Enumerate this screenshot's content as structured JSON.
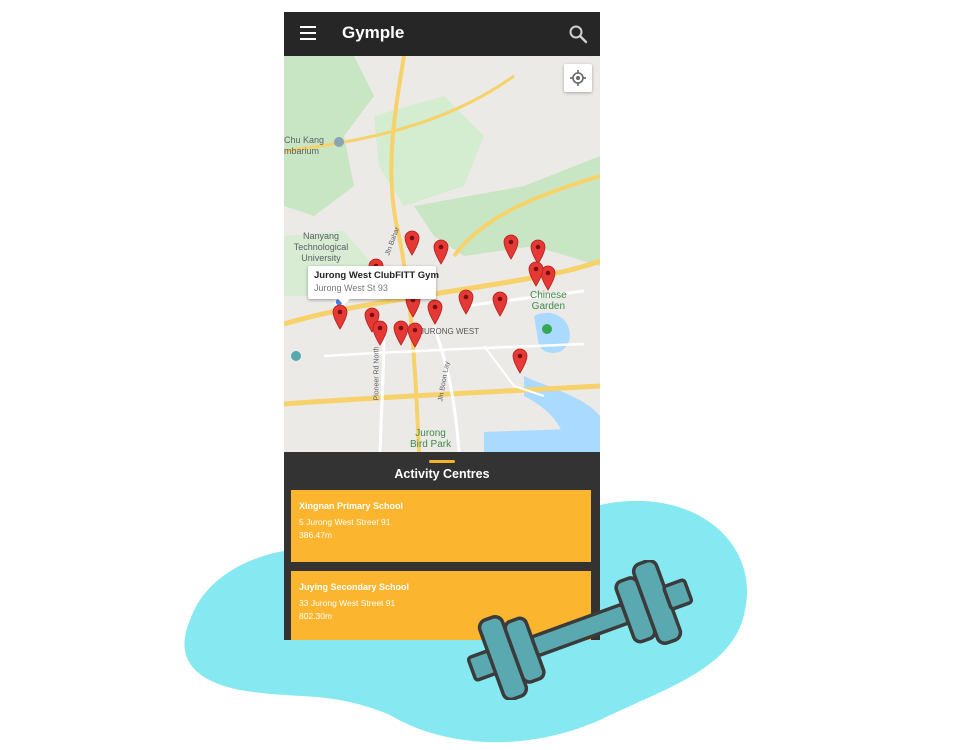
{
  "app": {
    "title": "Gymple"
  },
  "icons": {
    "menu": "hamburger-menu-icon",
    "search": "search-icon",
    "locate": "my-location-icon",
    "pin": "map-pin-icon"
  },
  "colors": {
    "accent": "#fbb52e",
    "appbar": "#262626",
    "sheet": "#333333",
    "pin": "#e53935",
    "blob": "#86e9f2",
    "dumbbell": "#5aa9b1"
  },
  "map": {
    "labels": {
      "chukang_1": "Chu Kang",
      "chukang_2": "mbarium",
      "ntu_1": "Nanyang",
      "ntu_2": "Technological",
      "ntu_3": "University",
      "chinese_1": "Chinese",
      "chinese_2": "Garden",
      "jurong_west": "JURONG WEST",
      "birdpark_1": "Jurong",
      "birdpark_2": "Bird Park",
      "pioneer": "Pioneer Rd North",
      "boon_lay": "Jln Boon Lay",
      "jln_bahar": "Jln Bahar"
    },
    "info_window": {
      "title": "Jurong West ClubFITT Gym",
      "subtitle": "Jurong West St 93"
    }
  },
  "sheet": {
    "title": "Activity Centres",
    "cards": [
      {
        "name": "Xingnan Primary School",
        "address": "5 Jurong West Street 91",
        "distance": "386.47m"
      },
      {
        "name": "Juying Secondary School",
        "address": "33 Jurong West Street 91",
        "distance": "802.30m"
      }
    ]
  }
}
